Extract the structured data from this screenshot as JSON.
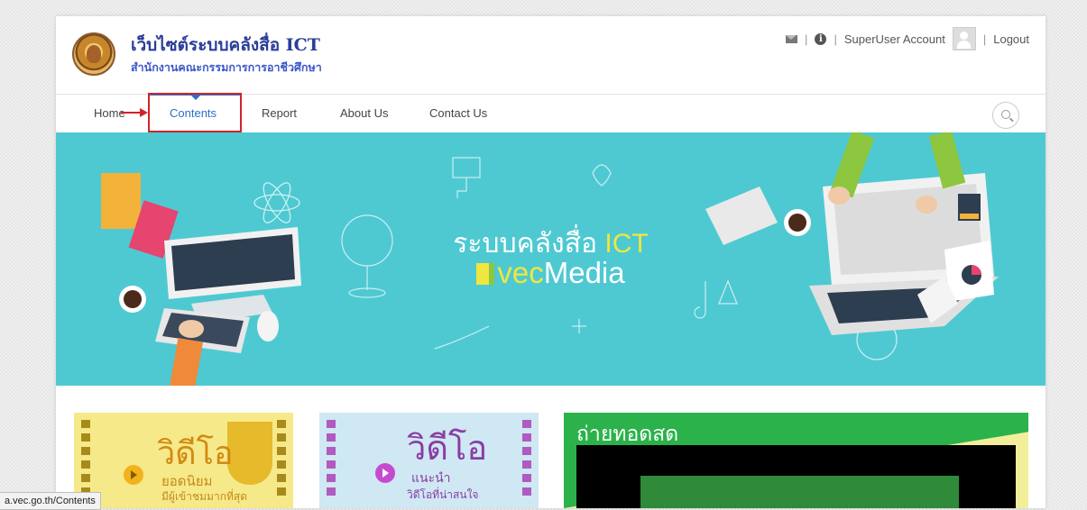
{
  "header": {
    "site_title": "เว็บไซต์ระบบคลังสื่อ ICT",
    "site_subtitle": "สำนักงานคณะกรรมการการอาชีวศึกษา",
    "account_label": "SuperUser Account",
    "logout_label": "Logout"
  },
  "nav": {
    "items": [
      {
        "label": "Home"
      },
      {
        "label": "Contents"
      },
      {
        "label": "Report"
      },
      {
        "label": "About Us"
      },
      {
        "label": "Contact Us"
      }
    ],
    "active": "Contents"
  },
  "banner": {
    "title_prefix": "ระบบคลังสื่อ ",
    "title_highlight": "ICT",
    "brand_highlight": "vec",
    "brand_rest": "Media"
  },
  "tiles": {
    "popular": {
      "big": "วิดีโอ",
      "line1": "ยอดนิยม",
      "line2": "มีผู้เข้าชมมากที่สุด"
    },
    "recommended": {
      "big": "วิดีโอ",
      "line1": "แนะนำ",
      "line2": "วิดีโอที่น่าสนใจ"
    },
    "live": {
      "title": "ถ่ายทอดสด"
    }
  },
  "status_bar": {
    "url": "a.vec.go.th/Contents"
  },
  "colors": {
    "brand_blue": "#2a3e99",
    "nav_active": "#2c6fc9",
    "highlight_red": "#d0242b",
    "banner_bg": "#4ec9d2",
    "live_green": "#2bb24a"
  }
}
